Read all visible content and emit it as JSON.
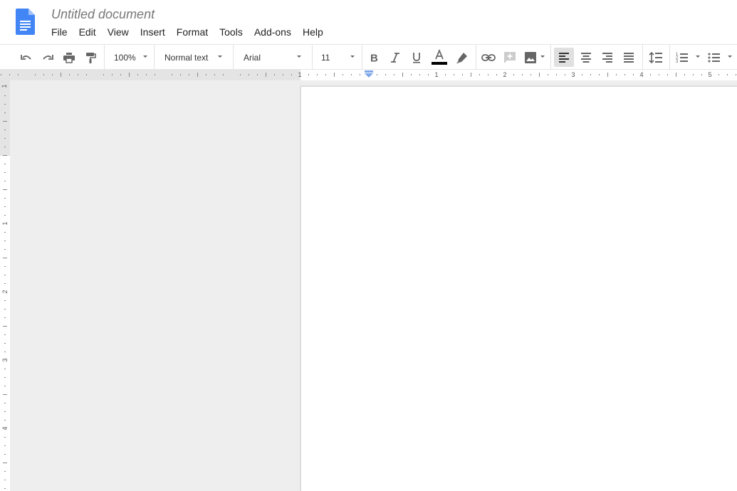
{
  "document": {
    "title": "Untitled document"
  },
  "menu": {
    "items": [
      {
        "id": "file",
        "label": "File"
      },
      {
        "id": "edit",
        "label": "Edit"
      },
      {
        "id": "view",
        "label": "View"
      },
      {
        "id": "insert",
        "label": "Insert"
      },
      {
        "id": "format",
        "label": "Format"
      },
      {
        "id": "tools",
        "label": "Tools"
      },
      {
        "id": "addons",
        "label": "Add-ons"
      },
      {
        "id": "help",
        "label": "Help"
      }
    ]
  },
  "toolbar": {
    "zoom": "100%",
    "style": "Normal text",
    "font": "Arial",
    "font_size": "11",
    "text_color": "#000000",
    "active_alignment": "left"
  },
  "ruler": {
    "horizontal_labels": [
      "1",
      "1",
      "2",
      "3",
      "4",
      "5"
    ],
    "vertical_labels": [
      "1",
      "1",
      "2",
      "3",
      "4"
    ]
  },
  "colors": {
    "brand": "#4285f4",
    "canvas": "#eeeeee"
  }
}
